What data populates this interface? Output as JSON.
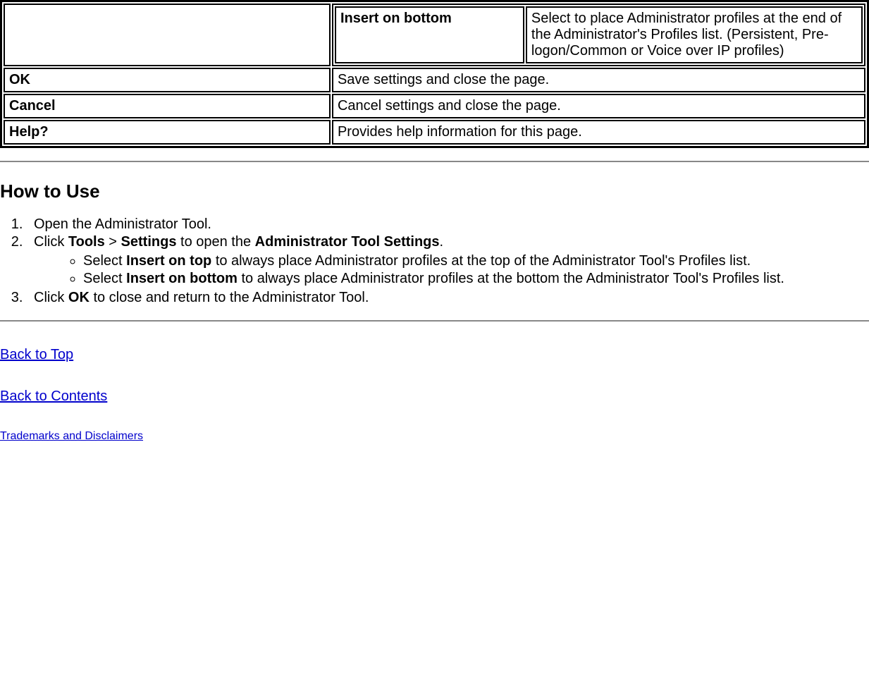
{
  "table": {
    "row_insert_bottom": {
      "label": "Insert on bottom",
      "desc": "Select to place Administrator profiles at the end of the Administrator's Profiles list. (Persistent, Pre-logon/Common or Voice over IP profiles)"
    },
    "row_ok": {
      "label": "OK",
      "desc": "Save settings and close the page."
    },
    "row_cancel": {
      "label": "Cancel",
      "desc": "Cancel settings and close the page."
    },
    "row_help": {
      "label": "Help?",
      "desc": "Provides help information for this page."
    }
  },
  "section": {
    "heading": "How to Use",
    "step1": "Open the Administrator Tool.",
    "step2_prefix": "Click ",
    "step2_tools": "Tools",
    "step2_gt": " > ",
    "step2_settings": "Settings",
    "step2_mid": " to open the ",
    "step2_target": "Administrator Tool Settings",
    "step2_end": ".",
    "sub_a_prefix": "Select ",
    "sub_a_bold": "Insert on top",
    "sub_a_rest": " to always place Administrator profiles at the top of the Administrator Tool's Profiles list.",
    "sub_b_prefix": "Select ",
    "sub_b_bold": "Insert on bottom",
    "sub_b_rest": " to always place Administrator profiles at the bottom the Administrator Tool's Profiles list.",
    "step3_prefix": "Click ",
    "step3_bold": "OK",
    "step3_rest": " to close and return to the Administrator Tool."
  },
  "links": {
    "back_top": "Back to Top",
    "back_contents": "Back to Contents",
    "trademarks": "Trademarks and Disclaimers"
  }
}
